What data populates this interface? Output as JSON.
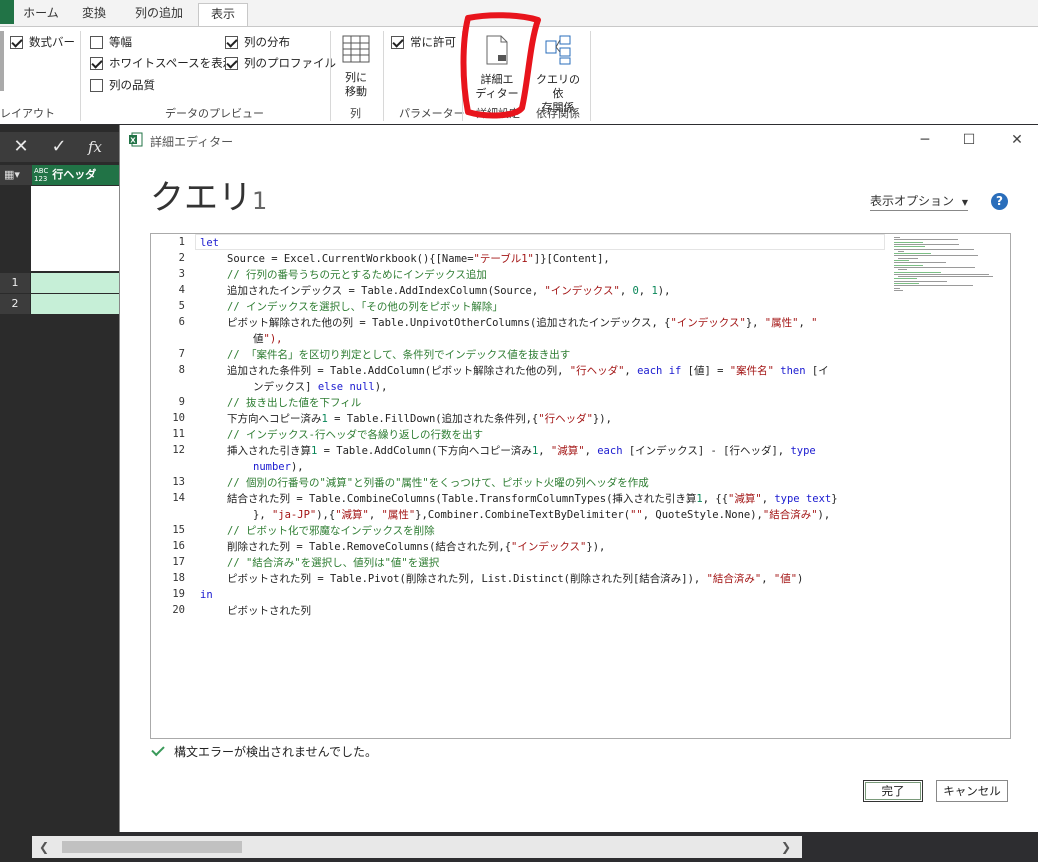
{
  "ribbon": {
    "tabs": [
      {
        "label": "ホーム"
      },
      {
        "label": "変換"
      },
      {
        "label": "列の追加"
      },
      {
        "label": "表示"
      }
    ],
    "checks": {
      "formula_bar": {
        "label": "数式バー",
        "checked": true
      },
      "monospace": {
        "label": "等幅",
        "checked": false
      },
      "show_whitespace": {
        "label": "ホワイトスペースを表示",
        "checked": true
      },
      "column_quality": {
        "label": "列の品質",
        "checked": false
      },
      "column_distribution": {
        "label": "列の分布",
        "checked": true
      },
      "column_profile": {
        "label": "列のプロファイル",
        "checked": true
      },
      "always_allow": {
        "label": "常に許可",
        "checked": true
      }
    },
    "buttons": {
      "go_to_column_l1": "列に",
      "go_to_column_l2": "移動",
      "advanced_editor_l1": "詳細エ",
      "advanced_editor_l2": "ディター",
      "query_deps_l1": "クエリの依",
      "query_deps_l2": "存関係"
    },
    "groups": {
      "layout": "レイアウト",
      "data_preview": "データのプレビュー",
      "columns": "列",
      "parameters": "パラメーター",
      "advanced": "詳細設定",
      "dependencies": "依存関係"
    }
  },
  "excel": {
    "column_type": "ABC\n123",
    "column_header": "行ヘッダ",
    "rows": [
      "1",
      "2"
    ]
  },
  "dialog": {
    "title": "詳細エディター",
    "heading": "クエリ",
    "heading_num": "1",
    "display_options": "表示オプション",
    "help": "?",
    "status": "構文エラーが検出されませんでした。",
    "done": "完了",
    "cancel": "キャンセル",
    "code": [
      {
        "n": "1",
        "t": "let"
      },
      {
        "n": "2",
        "t": "Source = Excel.CurrentWorkbook(){[Name=\"テーブル1\"]}[Content],"
      },
      {
        "n": "3",
        "t": "// 行列の番号うちの元とするためにインデックス追加"
      },
      {
        "n": "4",
        "t": "追加されたインデックス = Table.AddIndexColumn(Source, \"インデックス\", 0, 1),"
      },
      {
        "n": "5",
        "t": "// インデックスを選択し、「その他の列をピボット解除」"
      },
      {
        "n": "6",
        "t": "ピボット解除された他の列 = Table.UnpivotOtherColumns(追加されたインデックス, {\"インデックス\"}, \"属性\", \""
      },
      {
        "n": "",
        "t": "値\"),"
      },
      {
        "n": "7",
        "t": "// 「案件名」を区切り判定として、条件列でインデックス値を抜き出す"
      },
      {
        "n": "8",
        "t": "追加された条件列 = Table.AddColumn(ピボット解除された他の列, \"行ヘッダ\", each if [値] = \"案件名\" then [イ"
      },
      {
        "n": "",
        "t": "ンデックス] else null),"
      },
      {
        "n": "9",
        "t": "// 抜き出した値を下フィル"
      },
      {
        "n": "10",
        "t": "下方向へコピー済み1 = Table.FillDown(追加された条件列,{\"行ヘッダ\"}),"
      },
      {
        "n": "11",
        "t": "// インデックス-行ヘッダで各繰り返しの行数を出す"
      },
      {
        "n": "12",
        "t": "挿入された引き算1 = Table.AddColumn(下方向へコピー済み1, \"減算\", each [インデックス] - [行ヘッダ], type"
      },
      {
        "n": "",
        "t": "number),"
      },
      {
        "n": "13",
        "t": "// 個別の行番号の\"減算\"と列番の\"属性\"をくっつけて、ピボット火曜の列ヘッダを作成"
      },
      {
        "n": "14",
        "t": "結合された列 = Table.CombineColumns(Table.TransformColumnTypes(挿入された引き算1, {{\"減算\", type text}"
      },
      {
        "n": "",
        "t": "}, \"ja-JP\"),{\"減算\", \"属性\"},Combiner.CombineTextByDelimiter(\"\", QuoteStyle.None),\"結合済み\"),"
      },
      {
        "n": "15",
        "t": "// ピボット化で邪魔なインデックスを削除"
      },
      {
        "n": "16",
        "t": "削除された列 = Table.RemoveColumns(結合された列,{\"インデックス\"}),"
      },
      {
        "n": "17",
        "t": "// \"結合済み\"を選択し、値列は\"値\"を選択"
      },
      {
        "n": "18",
        "t": "ピボットされた列 = Table.Pivot(削除された列, List.Distinct(削除された列[結合済み]), \"結合済み\", \"値\")"
      },
      {
        "n": "19",
        "t": "in"
      },
      {
        "n": "20",
        "t": "ピボットされた列"
      }
    ]
  },
  "colors": {
    "excel_green": "#217346",
    "keyword": "#1a1ad0",
    "string": "#a31515",
    "comment": "#2e7d32",
    "highlight_red": "#e8141c"
  }
}
